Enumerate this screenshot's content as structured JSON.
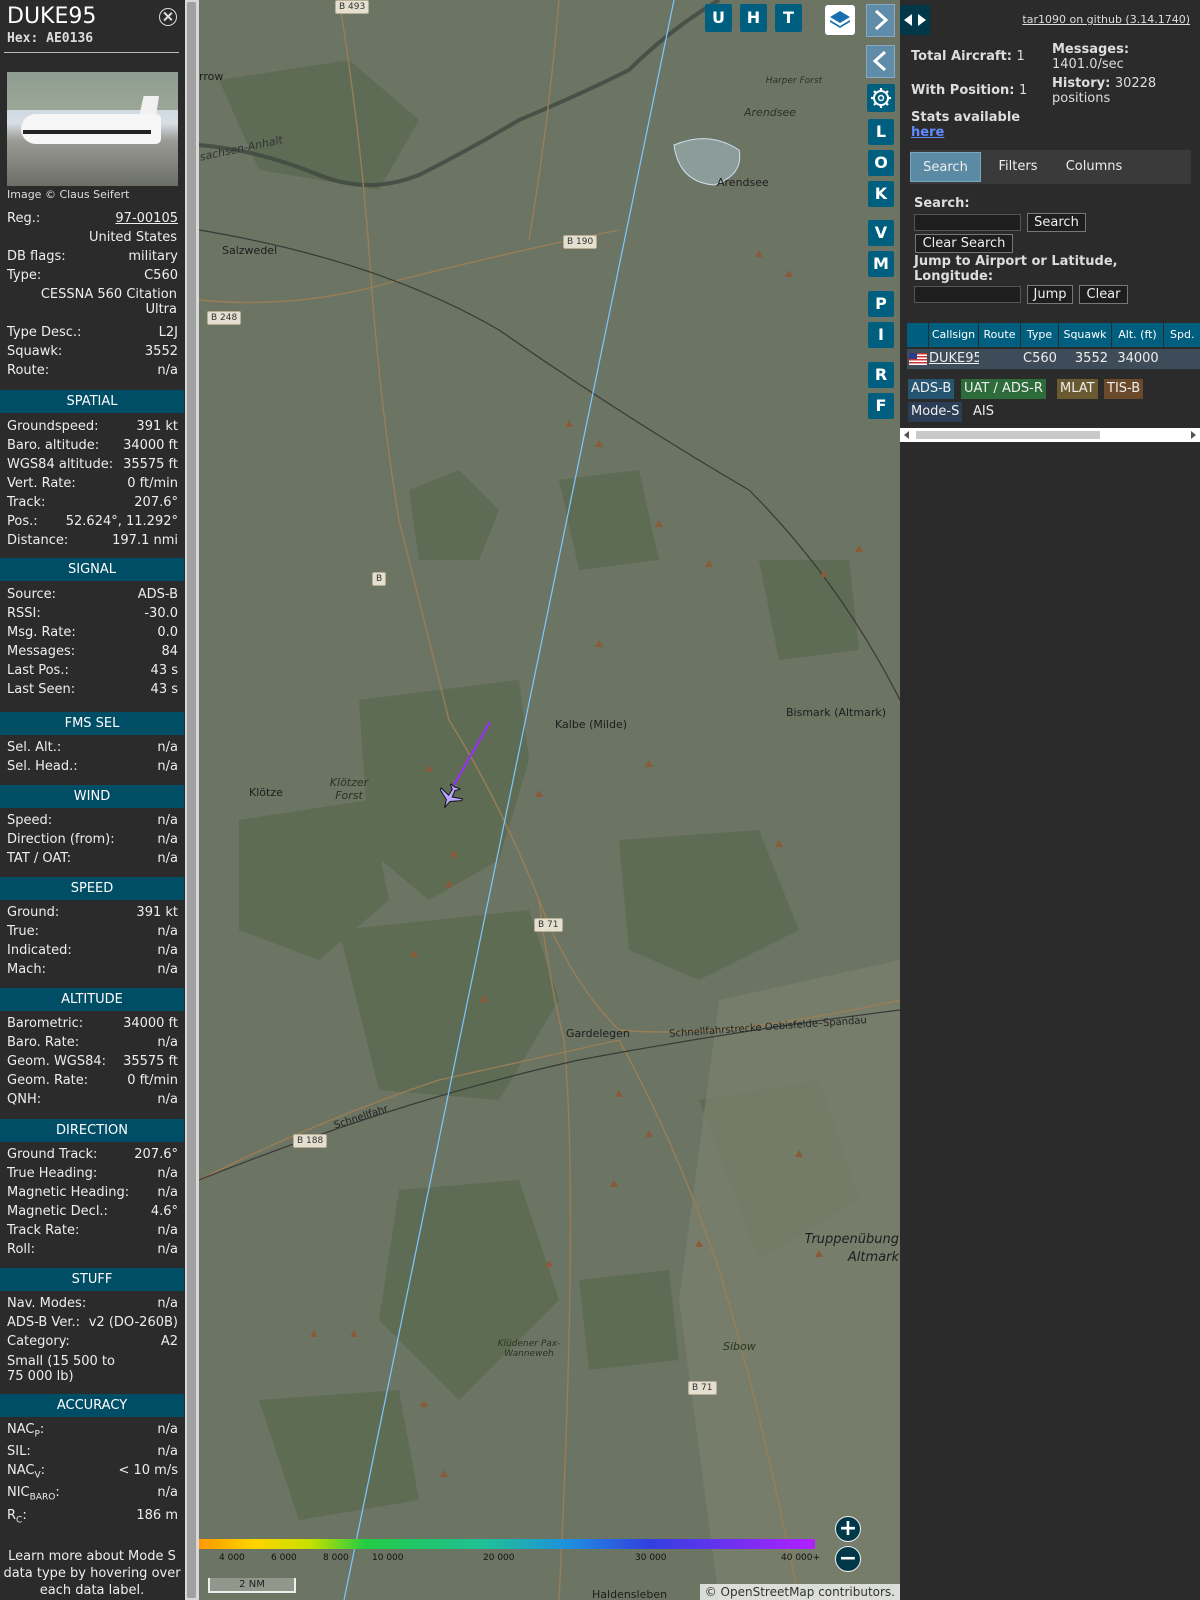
{
  "aircraft": {
    "callsign": "DUKE95",
    "hex": "Hex: AE0136",
    "image_credit": "Image © Claus Seifert"
  },
  "details": {
    "reg_label": "Reg.:",
    "reg_value": "97-00105",
    "country": "United States",
    "dbflags_label": "DB flags:",
    "dbflags_value": "military",
    "type_label": "Type:",
    "type_value": "C560",
    "type_full_1": "CESSNA 560 Citation",
    "type_full_2": "Ultra",
    "typedesc_label": "Type Desc.:",
    "typedesc_value": "L2J",
    "squawk_label": "Squawk:",
    "squawk_value": "3552",
    "route_label": "Route:",
    "route_value": "n/a"
  },
  "sections": {
    "spatial": "SPATIAL",
    "signal": "SIGNAL",
    "fms": "FMS SEL",
    "wind": "WIND",
    "speed": "SPEED",
    "altitude": "ALTITUDE",
    "direction": "DIRECTION",
    "stuff": "STUFF",
    "accuracy": "ACCURACY"
  },
  "spatial": [
    {
      "k": "Groundspeed:",
      "v": "391 kt"
    },
    {
      "k": "Baro. altitude:",
      "v": "34000 ft"
    },
    {
      "k": "WGS84 altitude:",
      "v": "35575 ft"
    },
    {
      "k": "Vert. Rate:",
      "v": "0 ft/min"
    },
    {
      "k": "Track:",
      "v": "207.6°"
    },
    {
      "k": "Pos.:",
      "v": "52.624°, 11.292°"
    },
    {
      "k": "Distance:",
      "v": "197.1 nmi"
    }
  ],
  "signal": [
    {
      "k": "Source:",
      "v": "ADS-B"
    },
    {
      "k": "RSSI:",
      "v": "-30.0"
    },
    {
      "k": "Msg. Rate:",
      "v": "0.0"
    },
    {
      "k": "Messages:",
      "v": "84"
    },
    {
      "k": "Last Pos.:",
      "v": "43 s"
    },
    {
      "k": "Last Seen:",
      "v": "43 s"
    }
  ],
  "fms": [
    {
      "k": "Sel. Alt.:",
      "v": "n/a"
    },
    {
      "k": "Sel. Head.:",
      "v": "n/a"
    }
  ],
  "wind": [
    {
      "k": "Speed:",
      "v": "n/a"
    },
    {
      "k": "Direction (from):",
      "v": "n/a"
    },
    {
      "k": "TAT / OAT:",
      "v": "n/a"
    }
  ],
  "speed": [
    {
      "k": "Ground:",
      "v": "391 kt"
    },
    {
      "k": "True:",
      "v": "n/a"
    },
    {
      "k": "Indicated:",
      "v": "n/a"
    },
    {
      "k": "Mach:",
      "v": "n/a"
    }
  ],
  "altitude": [
    {
      "k": "Barometric:",
      "v": "34000 ft"
    },
    {
      "k": "Baro. Rate:",
      "v": "n/a"
    },
    {
      "k": "Geom. WGS84:",
      "v": "35575 ft"
    },
    {
      "k": "Geom. Rate:",
      "v": "0 ft/min"
    },
    {
      "k": "QNH:",
      "v": "n/a"
    }
  ],
  "direction": [
    {
      "k": "Ground Track:",
      "v": "207.6°"
    },
    {
      "k": "True Heading:",
      "v": "n/a"
    },
    {
      "k": "Magnetic Heading:",
      "v": "n/a"
    },
    {
      "k": "Magnetic Decl.:",
      "v": "4.6°"
    },
    {
      "k": "Track Rate:",
      "v": "n/a"
    },
    {
      "k": "Roll:",
      "v": "n/a"
    }
  ],
  "stuff": [
    {
      "k": "Nav. Modes:",
      "v": "n/a"
    },
    {
      "k": "ADS-B Ver.:",
      "v": "v2 (DO-260B)"
    },
    {
      "k": "Category:",
      "v": "A2"
    }
  ],
  "category_desc_1": "Small (15 500 to",
  "category_desc_2": "75 000 lb)",
  "accuracy": [
    {
      "k": "NAC",
      "sub": "P",
      "v": "n/a"
    },
    {
      "k": "SIL:",
      "sub": "",
      "v": "n/a"
    },
    {
      "k": "NAC",
      "sub": "V",
      "v": "< 10 m/s"
    },
    {
      "k": "NIC",
      "sub": "BARO",
      "v": "n/a"
    },
    {
      "k": "R",
      "sub": "C",
      "v": "186 m"
    }
  ],
  "learn_more": [
    "Learn more about Mode S",
    "data type by hovering over",
    "each data label."
  ],
  "map": {
    "buttons_top": [
      "U",
      "H",
      "T"
    ],
    "buttons_side": [
      "L",
      "O",
      "K",
      "V",
      "M",
      "P",
      "I",
      "R",
      "F"
    ],
    "places": [
      "rrow",
      "sachsen-Anhalt",
      "Harper Forst",
      "Arendsee",
      "Arendsee",
      "Salzwedel",
      "Kalbe (Milde)",
      "Bismark (Altmark)",
      "Klötze",
      "Klötzer Forst",
      "Gardelegen",
      "Schnellfahrstrecke Oebisfelde–Spandau",
      "Schnellfahr",
      "Truppenübung",
      "Altmark",
      "Sibow",
      "Klüdener Pax-Wanneweh",
      "Haldensleben"
    ],
    "roads": [
      "B 493",
      "B 190",
      "B 248",
      "B",
      "B 71",
      "B 188",
      "B 71"
    ],
    "alt_ticks": [
      "4 000",
      "6 000",
      "8 000",
      "10 000",
      "20 000",
      "30 000",
      "40 000+"
    ],
    "scale": "2 NM",
    "attribution": "© OpenStreetMap contributors.",
    "zoom_in": "+",
    "zoom_out": "−",
    "colors": {
      "track": "#9a2cff",
      "route_line": "#7fc7ff"
    }
  },
  "panel": {
    "github": "tar1090 on github (3.14.1740)",
    "total_label": "Total Aircraft:",
    "total_value": "1",
    "withpos_label": "With Position:",
    "withpos_value": "1",
    "messages_label": "Messages:",
    "messages_value": "1401.0/sec",
    "history_label": "History:",
    "history_value_1": "30228",
    "history_value_2": "positions",
    "stats_label": "Stats available",
    "stats_link": "here",
    "tabs": [
      "Search",
      "Filters",
      "Columns"
    ],
    "search_label": "Search:",
    "search_button": "Search",
    "clear_search_button": "Clear Search",
    "jump_label_1": "Jump to Airport or Latitude,",
    "jump_label_2": "Longitude:",
    "jump_button": "Jump",
    "clear_button": "Clear",
    "table_headers": [
      "Callsign",
      "Route",
      "Type",
      "Squawk",
      "Alt. (ft)",
      "Spd."
    ],
    "table_row": {
      "callsign": "DUKE95",
      "route": "",
      "type": "C560",
      "squawk": "3552",
      "alt": "34000"
    },
    "badges": [
      "ADS-B",
      "UAT / ADS-R",
      "MLAT",
      "TIS-B",
      "Mode-S",
      "AIS"
    ]
  }
}
